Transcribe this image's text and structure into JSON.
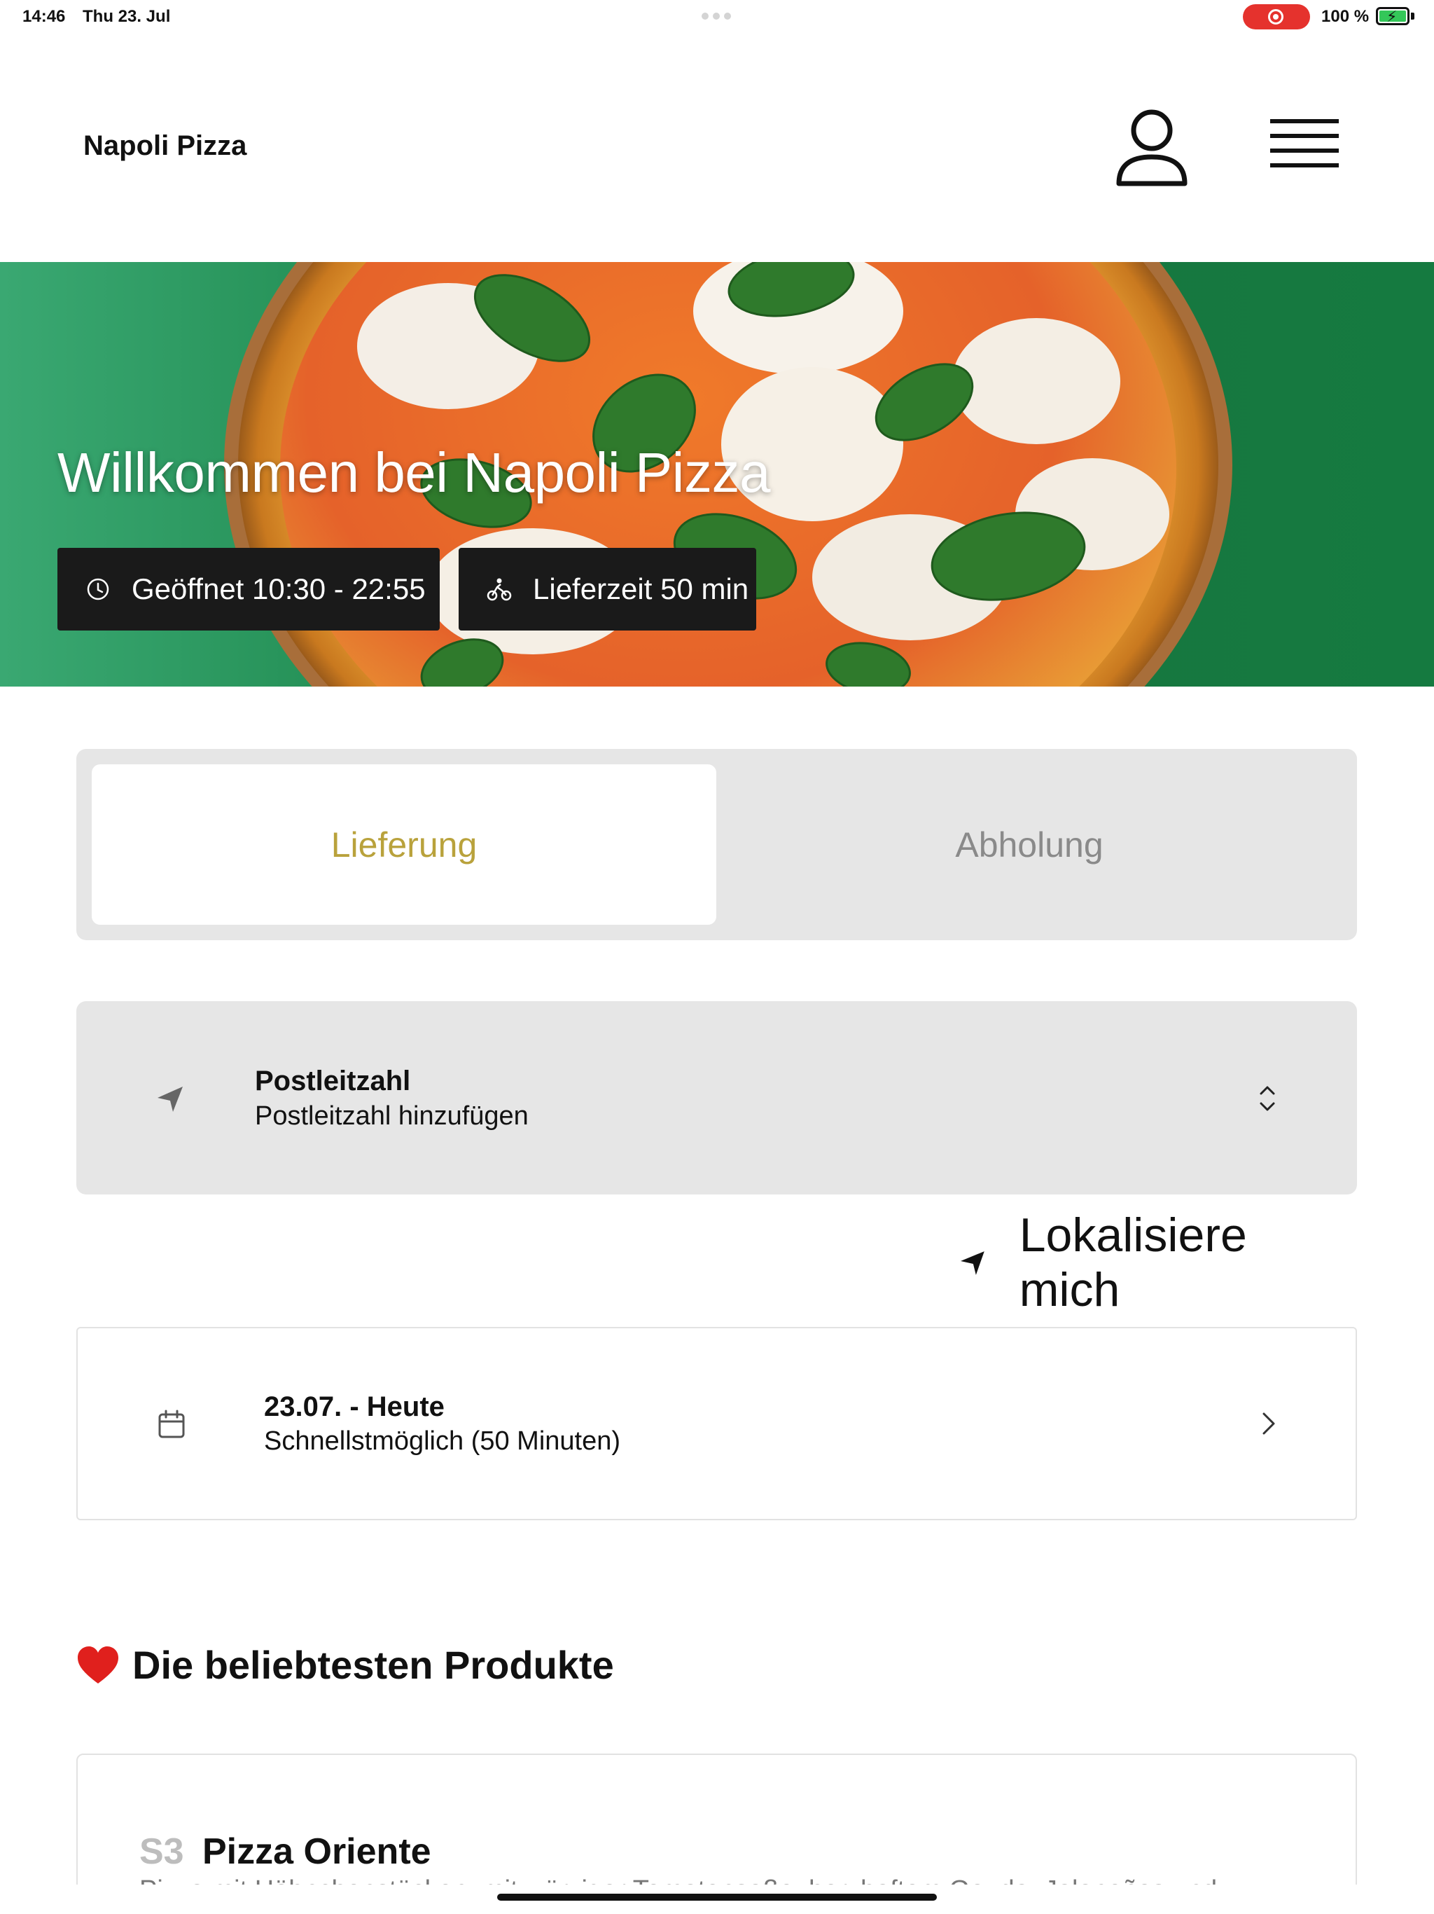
{
  "status_bar": {
    "time": "14:46",
    "date": "Thu 23. Jul",
    "battery": "100 %"
  },
  "header": {
    "brand": "Napoli Pizza",
    "profile_icon": "person-icon",
    "menu_icon": "hamburger-menu-icon"
  },
  "hero": {
    "title": "Willkommen bei Napoli Pizza",
    "opening_hours": "Geöffnet 10:30 - 22:55",
    "delivery_time": "Lieferzeit 50 min",
    "colors": {
      "background": "#17773f",
      "badge": "#1a1a1a"
    }
  },
  "order_mode": {
    "options": [
      "Lieferung",
      "Abholung"
    ],
    "selected": "Lieferung",
    "colors": {
      "active_text": "#b9a23c",
      "inactive_text": "#8a8a8a"
    }
  },
  "postal_code": {
    "label": "Postleitzahl",
    "value": "Postleitzahl hinzufügen"
  },
  "locate": {
    "label": "Lokalisiere mich"
  },
  "delivery_date": {
    "day": "23.07. - Heute",
    "time": "Schnellstmöglich (50 Minuten)"
  },
  "popular": {
    "heading": "Die beliebtesten Produkte",
    "products": [
      {
        "code": "S3",
        "name": "Pizza Oriente",
        "description": "Pizza mit Hähnchenstücken, mit würziger Tomatensoße, herzhaftem Gouda, Jalapeños und"
      }
    ]
  }
}
